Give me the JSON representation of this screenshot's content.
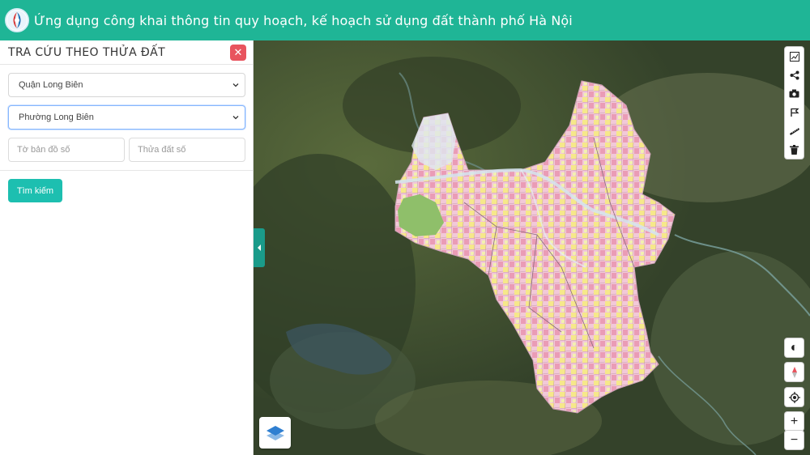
{
  "header": {
    "title": "Ứng dụng công khai thông tin quy hoạch, kế hoạch sử dụng đất thành phố Hà Nội",
    "color": "#1fb596"
  },
  "panel": {
    "title": "TRA CỨU THEO THỬA ĐẤT",
    "close_icon": "close-icon",
    "district_select": {
      "value": "Quận Long Biên"
    },
    "ward_select": {
      "value": "Phường Long Biên"
    },
    "map_sheet_input": {
      "placeholder": "Tờ bản đồ số"
    },
    "parcel_input": {
      "placeholder": "Thửa đất số"
    },
    "search_label": "Tìm kiếm"
  },
  "map": {
    "tools": [
      "chart-icon",
      "share-icon",
      "camera-icon",
      "flag-icon",
      "ruler-icon",
      "trash-icon"
    ],
    "controls": {
      "contrast": "◐",
      "zoom_in": "+",
      "zoom_out": "−"
    }
  },
  "colors": {
    "accent": "#1dbfb0",
    "close": "#e8545e"
  }
}
